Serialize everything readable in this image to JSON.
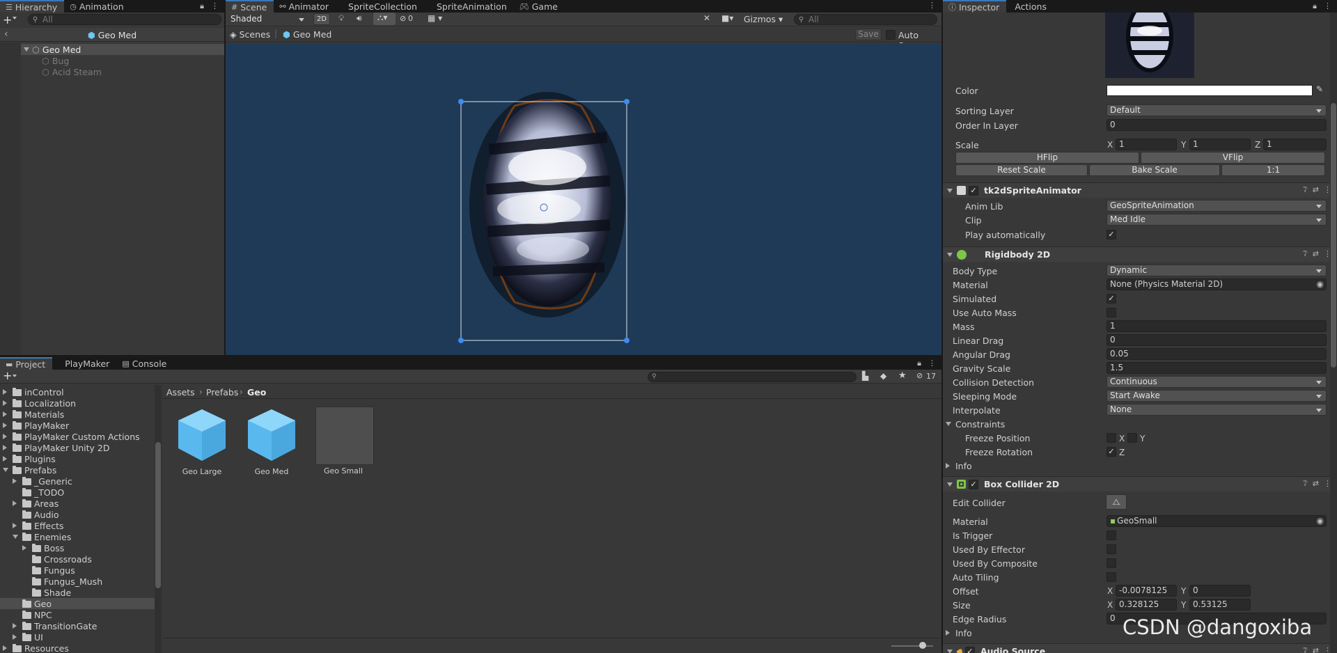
{
  "hierarchy": {
    "tab_label": "Hierarchy",
    "tab2_label": "Animation",
    "search_placeholder": "All",
    "scene_name": "Geo Med",
    "items": [
      {
        "label": "Geo Med"
      },
      {
        "label": "Bug"
      },
      {
        "label": "Acid Steam"
      }
    ]
  },
  "scene": {
    "tabs": [
      "Scene",
      "Animator",
      "SpriteCollection",
      "SpriteAnimation",
      "Game"
    ],
    "shading_mode": "Shaded",
    "mode_2d": "2D",
    "hidden_count": "0",
    "gizmos_label": "Gizmos",
    "search_placeholder": "All",
    "breadcrumb_root": "Scenes",
    "breadcrumb_item": "Geo Med",
    "save_label": "Save",
    "autosave_label": "Auto Save",
    "background_color": "#1f3a56",
    "collider_color": "#f07a1e"
  },
  "project": {
    "tabs": [
      "Project",
      "PlayMaker",
      "Console"
    ],
    "hidden_count": "17",
    "breadcrumb": [
      "Assets",
      "Prefabs",
      "Geo"
    ],
    "tree": [
      {
        "label": "inControl",
        "arrow": true,
        "indent": 0
      },
      {
        "label": "Localization",
        "arrow": true,
        "indent": 0
      },
      {
        "label": "Materials",
        "arrow": true,
        "indent": 0
      },
      {
        "label": "PlayMaker",
        "arrow": true,
        "indent": 0
      },
      {
        "label": "PlayMaker Custom Actions",
        "arrow": true,
        "indent": 0
      },
      {
        "label": "PlayMaker Unity 2D",
        "arrow": true,
        "indent": 0
      },
      {
        "label": "Plugins",
        "arrow": true,
        "indent": 0
      },
      {
        "label": "Prefabs",
        "arrow": "open",
        "indent": 0
      },
      {
        "label": "_Generic",
        "arrow": true,
        "indent": 1
      },
      {
        "label": "_TODO",
        "arrow": false,
        "indent": 1
      },
      {
        "label": "Areas",
        "arrow": true,
        "indent": 1
      },
      {
        "label": "Audio",
        "arrow": false,
        "indent": 1
      },
      {
        "label": "Effects",
        "arrow": true,
        "indent": 1
      },
      {
        "label": "Enemies",
        "arrow": "open",
        "indent": 1
      },
      {
        "label": "Boss",
        "arrow": true,
        "indent": 2
      },
      {
        "label": "Crossroads",
        "arrow": false,
        "indent": 2
      },
      {
        "label": "Fungus",
        "arrow": false,
        "indent": 2
      },
      {
        "label": "Fungus_Mush",
        "arrow": false,
        "indent": 2
      },
      {
        "label": "Shade",
        "arrow": false,
        "indent": 2
      },
      {
        "label": "Geo",
        "arrow": false,
        "indent": 1,
        "selected": true
      },
      {
        "label": "NPC",
        "arrow": false,
        "indent": 1
      },
      {
        "label": "TransitionGate",
        "arrow": true,
        "indent": 1
      },
      {
        "label": "UI",
        "arrow": true,
        "indent": 1
      },
      {
        "label": "Resources",
        "arrow": true,
        "indent": 0
      }
    ],
    "assets": [
      {
        "label": "Geo Large",
        "type": "prefab"
      },
      {
        "label": "Geo Med",
        "type": "prefab"
      },
      {
        "label": "Geo Small",
        "type": "empty"
      }
    ]
  },
  "inspector": {
    "tab_label": "Inspector",
    "tab2_label": "Actions",
    "sprite": {
      "color_label": "Color",
      "sorting_layer_label": "Sorting Layer",
      "sorting_layer_value": "Default",
      "order_label": "Order In Layer",
      "order_value": "0",
      "scale_label": "Scale",
      "scale_x": "1",
      "scale_y": "1",
      "scale_z": "1",
      "hflip": "HFlip",
      "vflip": "VFlip",
      "reset_scale": "Reset Scale",
      "bake_scale": "Bake Scale",
      "one_to_one": "1:1"
    },
    "animator": {
      "title": "tk2dSpriteAnimator",
      "anim_lib_label": "Anim Lib",
      "anim_lib_value": "GeoSpriteAnimation",
      "clip_label": "Clip",
      "clip_value": "Med Idle",
      "play_auto_label": "Play automatically"
    },
    "rigidbody": {
      "title": "Rigidbody 2D",
      "body_type_label": "Body Type",
      "body_type_value": "Dynamic",
      "material_label": "Material",
      "material_value": "None (Physics Material 2D)",
      "simulated_label": "Simulated",
      "auto_mass_label": "Use Auto Mass",
      "mass_label": "Mass",
      "mass_value": "1",
      "linear_drag_label": "Linear Drag",
      "linear_drag_value": "0",
      "angular_drag_label": "Angular Drag",
      "angular_drag_value": "0.05",
      "gravity_label": "Gravity Scale",
      "gravity_value": "1.5",
      "collision_label": "Collision Detection",
      "collision_value": "Continuous",
      "sleeping_label": "Sleeping Mode",
      "sleeping_value": "Start Awake",
      "interpolate_label": "Interpolate",
      "interpolate_value": "None",
      "constraints_label": "Constraints",
      "freeze_pos_label": "Freeze Position",
      "freeze_rot_label": "Freeze Rotation",
      "info_label": "Info"
    },
    "box_collider": {
      "title": "Box Collider 2D",
      "edit_collider_label": "Edit Collider",
      "material_label": "Material",
      "material_value": "GeoSmall",
      "is_trigger_label": "Is Trigger",
      "used_by_effector_label": "Used By Effector",
      "used_by_composite_label": "Used By Composite",
      "auto_tiling_label": "Auto Tiling",
      "offset_label": "Offset",
      "offset_x": "-0.0078125",
      "offset_y": "0",
      "size_label": "Size",
      "size_x": "0.328125",
      "size_y": "0.53125",
      "edge_radius_label": "Edge Radius",
      "edge_radius_value": "0",
      "info_label": "Info"
    },
    "audio_source": {
      "title": "Audio Source"
    }
  },
  "axis": {
    "x": "X",
    "y": "Y",
    "z": "Z"
  },
  "watermark": "CSDN @dangoxiba"
}
